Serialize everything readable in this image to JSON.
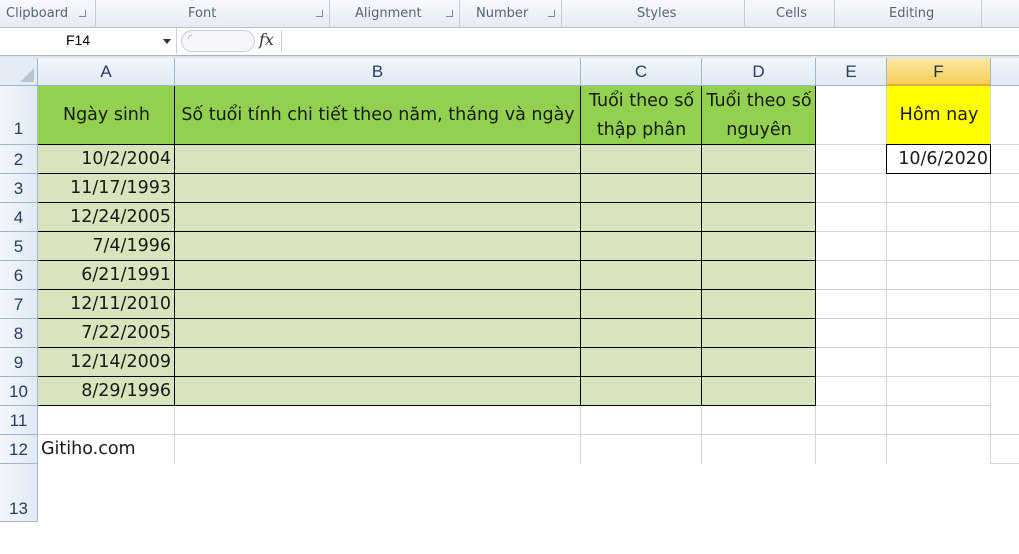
{
  "ribbon": {
    "groups": [
      {
        "label": "Clipboard",
        "launcher": true
      },
      {
        "label": "Font",
        "launcher": true
      },
      {
        "label": "Alignment",
        "launcher": true
      },
      {
        "label": "Number",
        "launcher": true
      },
      {
        "label": "Styles",
        "launcher": false
      },
      {
        "label": "Cells",
        "launcher": false
      },
      {
        "label": "Editing",
        "launcher": false
      }
    ]
  },
  "formula_bar": {
    "name_box": "F14",
    "fx_symbol": "fx",
    "formula": ""
  },
  "grid": {
    "column_headers": [
      "A",
      "B",
      "C",
      "D",
      "E",
      "F"
    ],
    "active_column": "F",
    "row_headers": [
      "1",
      "2",
      "3",
      "4",
      "5",
      "6",
      "7",
      "8",
      "9",
      "10",
      "11",
      "12",
      "13"
    ]
  },
  "sheet": {
    "header_row": {
      "A1": "Ngày sinh",
      "B1": "Số tuổi tính chi tiết theo năm, tháng và ngày",
      "C1": "Tuổi theo số thập phân",
      "D1": "Tuổi theo số nguyên",
      "F1": "Hôm nay"
    },
    "today_value": "10/6/2020",
    "birth_dates": [
      "10/2/2004",
      "11/17/1993",
      "12/24/2005",
      "7/4/1996",
      "6/21/1991",
      "12/11/2010",
      "7/22/2005",
      "12/14/2009",
      "8/29/1996"
    ],
    "footer_text": "Gitiho.com"
  },
  "colors": {
    "header_fill": "#92d050",
    "data_fill": "#d8e4bc",
    "today_fill": "#ffff00"
  }
}
